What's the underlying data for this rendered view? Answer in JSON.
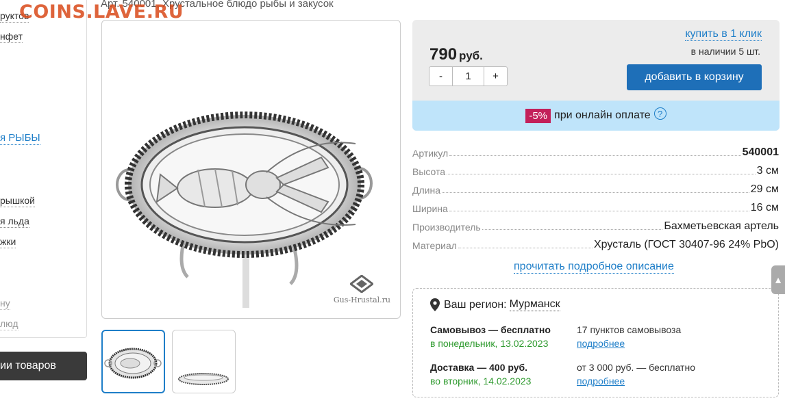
{
  "watermark": "COINS.LAVE.RU",
  "sidebar": {
    "items": [
      {
        "label": "руктов"
      },
      {
        "label": "нфет"
      },
      {
        "label": "я РЫБЫ"
      },
      {
        "label": "рышкой"
      },
      {
        "label": "я льда"
      },
      {
        "label": "жки"
      },
      {
        "label": "ну"
      },
      {
        "label": "люд"
      }
    ],
    "dark_block": "ии товаров"
  },
  "product": {
    "article_line": "Арт. 540001, Хрустальное блюдо рыбы и закусок",
    "brand_logo_text": "Gus-Hrustal.ru"
  },
  "buy": {
    "price": "790",
    "currency": "руб.",
    "qty_minus": "-",
    "qty_value": "1",
    "qty_plus": "+",
    "one_click": "купить в 1 клик",
    "stock": "в наличии 5 шт.",
    "add_to_cart": "добавить в корзину",
    "discount_badge": "-5%",
    "discount_text": "при онлайн оплате",
    "help_icon": "?"
  },
  "specs": [
    {
      "label": "Артикул",
      "value": "540001",
      "bold": true
    },
    {
      "label": "Высота",
      "value": "3 см"
    },
    {
      "label": "Длина",
      "value": "29 см"
    },
    {
      "label": "Ширина",
      "value": "16 см"
    },
    {
      "label": "Производитель",
      "value": "Бахметьевская артель"
    },
    {
      "label": "Материал",
      "value": "Хрусталь (ГОСТ 30407-96 24% PbO)"
    }
  ],
  "read_more": "прочитать подробное описание",
  "delivery": {
    "region_label": "Ваш регион:",
    "region_city": "Мурманск",
    "pickup_title": "Самовывоз — бесплатно",
    "pickup_date": "в понедельник, 13.02.2023",
    "pickup_info": "17 пунктов самовывоза",
    "pickup_link": "подробнее",
    "delivery_title": "Доставка — 400 руб.",
    "delivery_date": "во вторник, 14.02.2023",
    "delivery_info": "от 3 000 руб. — бесплатно",
    "delivery_link": "подробнее"
  },
  "colors": {
    "accent": "#1e6fb8",
    "discount_badge": "#c3205a",
    "discount_bar": "#bfe4fa",
    "date_green": "#2e9a2e"
  }
}
